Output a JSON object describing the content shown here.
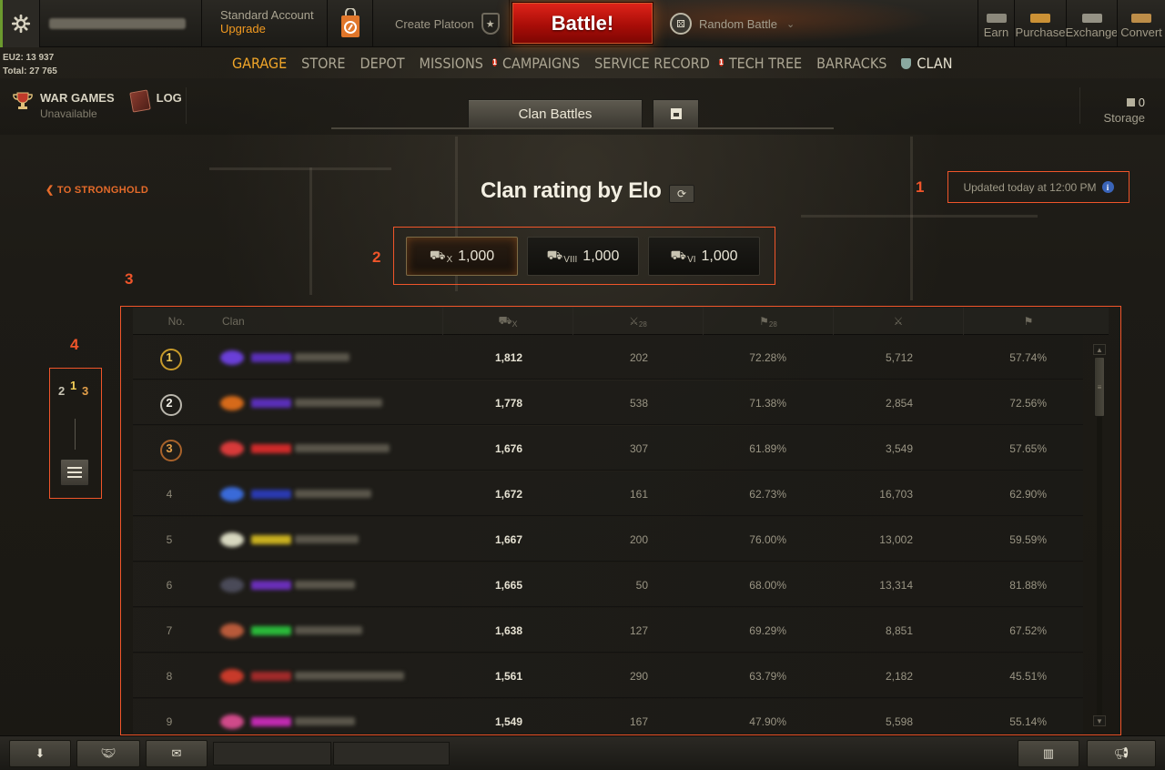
{
  "topbar": {
    "account_type": "Standard Account",
    "upgrade_label": "Upgrade",
    "create_platoon": "Create Platoon",
    "battle_label": "Battle!",
    "battle_mode": "Random Battle",
    "wallet": [
      {
        "label": "Earn",
        "color": "#9d9a8c"
      },
      {
        "label": "Purchase",
        "color": "#e9a43a"
      },
      {
        "label": "Exchange",
        "color": "#a9a698"
      },
      {
        "label": "Convert",
        "color": "#d8a050"
      }
    ]
  },
  "balance": {
    "line1": "EU2: 13 937",
    "line2": "Total: 27 765"
  },
  "nav": {
    "items": [
      "GARAGE",
      "STORE",
      "DEPOT",
      "MISSIONS",
      "CAMPAIGNS",
      "SERVICE RECORD",
      "TECH TREE",
      "BARRACKS",
      "CLAN"
    ],
    "badge_missions": "1",
    "badge_service": "1"
  },
  "subheader": {
    "war_games": "WAR GAMES",
    "war_games_status": "Unavailable",
    "log": "LOG",
    "clan_battles": "Clan Battles",
    "storage_count": "0",
    "storage_label": "Storage"
  },
  "content": {
    "back_link": "TO STRONGHOLD",
    "title": "Clan rating by Elo",
    "updated": "Updated today at 12:00 PM",
    "annotations": [
      "1",
      "2",
      "3",
      "4"
    ],
    "tiers": [
      {
        "tier": "X",
        "value": "1,000",
        "selected": true
      },
      {
        "tier": "VIII",
        "value": "1,000",
        "selected": false
      },
      {
        "tier": "VI",
        "value": "1,000",
        "selected": false
      }
    ]
  },
  "table": {
    "headers": {
      "no": "No.",
      "clan": "Clan",
      "elo_tier": "X",
      "battles_sub": "28",
      "wins_sub": "28"
    },
    "rows": [
      {
        "no": "1",
        "elo": "1,812",
        "battles": "202",
        "wins": "72.28%",
        "total": "5,712",
        "rate": "57.74%",
        "emblem": "#6a3fd8",
        "tag": "#5a2fb8",
        "name_w": 60
      },
      {
        "no": "2",
        "elo": "1,778",
        "battles": "538",
        "wins": "71.38%",
        "total": "2,854",
        "rate": "72.56%",
        "emblem": "#d66a1a",
        "tag": "#5a2fb8",
        "name_w": 96
      },
      {
        "no": "3",
        "elo": "1,676",
        "battles": "307",
        "wins": "61.89%",
        "total": "3,549",
        "rate": "57.65%",
        "emblem": "#d83a3a",
        "tag": "#d02a2a",
        "name_w": 104
      },
      {
        "no": "4",
        "elo": "1,672",
        "battles": "161",
        "wins": "62.73%",
        "total": "16,703",
        "rate": "62.90%",
        "emblem": "#3a6ad8",
        "tag": "#2a3ab0",
        "name_w": 84
      },
      {
        "no": "5",
        "elo": "1,667",
        "battles": "200",
        "wins": "76.00%",
        "total": "13,002",
        "rate": "59.59%",
        "emblem": "#d8d8c0",
        "tag": "#c8b020",
        "name_w": 70
      },
      {
        "no": "6",
        "elo": "1,665",
        "battles": "50",
        "wins": "68.00%",
        "total": "13,314",
        "rate": "81.88%",
        "emblem": "#4a4a58",
        "tag": "#6a2fb8",
        "name_w": 66
      },
      {
        "no": "7",
        "elo": "1,638",
        "battles": "127",
        "wins": "69.29%",
        "total": "8,851",
        "rate": "67.52%",
        "emblem": "#b85a3a",
        "tag": "#2ab83a",
        "name_w": 74
      },
      {
        "no": "8",
        "elo": "1,561",
        "battles": "290",
        "wins": "63.79%",
        "total": "2,182",
        "rate": "45.51%",
        "emblem": "#c83a2a",
        "tag": "#a02a2a",
        "name_w": 120
      },
      {
        "no": "9",
        "elo": "1,549",
        "battles": "167",
        "wins": "47.90%",
        "total": "5,598",
        "rate": "55.14%",
        "emblem": "#d04a8a",
        "tag": "#c02ab0",
        "name_w": 66
      }
    ]
  },
  "sidebar_switch": {
    "podium_labels": [
      "2",
      "1",
      "3"
    ]
  },
  "colors": {
    "accent": "#f1a629",
    "annotation": "#f0552a",
    "battle": "#c0150e"
  }
}
